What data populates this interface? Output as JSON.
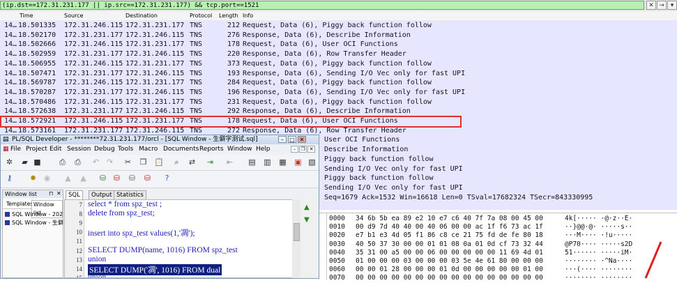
{
  "filter": {
    "text": "(ip.dst==172.31.231.177 || ip.src==172.31.231.177) && tcp.port==1521"
  },
  "packet_list": {
    "columns": [
      "Time",
      "Source",
      "Destination",
      "Protocol",
      "Length",
      "Info"
    ],
    "rows": [
      {
        "no": "14…",
        "time": "18.501335",
        "src": "172.31.246.115",
        "dst": "172.31.231.177",
        "proto": "TNS",
        "len": "212",
        "info": "Request, Data (6), Piggy back function follow"
      },
      {
        "no": "14…",
        "time": "18.502170",
        "src": "172.31.231.177",
        "dst": "172.31.246.115",
        "proto": "TNS",
        "len": "276",
        "info": "Response, Data (6), Describe Information"
      },
      {
        "no": "14…",
        "time": "18.502666",
        "src": "172.31.246.115",
        "dst": "172.31.231.177",
        "proto": "TNS",
        "len": "178",
        "info": "Request, Data (6), User OCI Functions"
      },
      {
        "no": "14…",
        "time": "18.502959",
        "src": "172.31.231.177",
        "dst": "172.31.246.115",
        "proto": "TNS",
        "len": "220",
        "info": "Response, Data (6), Row Transfer Header"
      },
      {
        "no": "14…",
        "time": "18.506955",
        "src": "172.31.246.115",
        "dst": "172.31.231.177",
        "proto": "TNS",
        "len": "373",
        "info": "Request, Data (6), Piggy back function follow"
      },
      {
        "no": "14…",
        "time": "18.507471",
        "src": "172.31.231.177",
        "dst": "172.31.246.115",
        "proto": "TNS",
        "len": "193",
        "info": "Response, Data (6), Sending I/O Vec only for fast UPI"
      },
      {
        "no": "14…",
        "time": "18.569787",
        "src": "172.31.246.115",
        "dst": "172.31.231.177",
        "proto": "TNS",
        "len": "284",
        "info": "Request, Data (6), Piggy back function follow"
      },
      {
        "no": "14…",
        "time": "18.570287",
        "src": "172.31.231.177",
        "dst": "172.31.246.115",
        "proto": "TNS",
        "len": "196",
        "info": "Response, Data (6), Sending I/O Vec only for fast UPI"
      },
      {
        "no": "14…",
        "time": "18.570486",
        "src": "172.31.246.115",
        "dst": "172.31.231.177",
        "proto": "TNS",
        "len": "231",
        "info": "Request, Data (6), Piggy back function follow"
      },
      {
        "no": "14…",
        "time": "18.572638",
        "src": "172.31.231.177",
        "dst": "172.31.246.115",
        "proto": "TNS",
        "len": "292",
        "info": "Response, Data (6), Describe Information"
      },
      {
        "no": "14…",
        "time": "18.572921",
        "src": "172.31.246.115",
        "dst": "172.31.231.177",
        "proto": "TNS",
        "len": "178",
        "info": "Request, Data (6), User OCI Functions"
      },
      {
        "no": "14…",
        "time": "18.573161",
        "src": "172.31.231.177",
        "dst": "172.31.246.115",
        "proto": "TNS",
        "len": "272",
        "info": "Response, Data (6), Row Transfer Header"
      }
    ],
    "hidden_info": [
      "User OCI Functions",
      "Describe Information",
      "Piggy back function follow",
      "Sending I/O Vec only for fast UPI",
      "Piggy back function follow",
      "Sending I/O Vec only for fast UPI",
      "Seq=1679 Ack=1532 Win=16618 Len=0 TSval=17682324 TSecr=843330995"
    ]
  },
  "hex_pane": {
    "rows": [
      {
        "offset": "0000",
        "hex": "34 6b 5b ea 89 e2 10 e7  c6 40 7f 7a 08 00 45 00",
        "ascii": "4k[·····  ·@·z··E·"
      },
      {
        "offset": "0010",
        "hex": "00 d9 7d 40 40 00 40 06  00 00 ac 1f f6 73 ac 1f",
        "ascii": "··}@@·@·  ·····s··"
      },
      {
        "offset": "0020",
        "hex": "e7 b1 e3 4d 05 f1 86 c8  ce 21 75 fd de fe 80 18",
        "ascii": "···M····  ·!u·····"
      },
      {
        "offset": "0030",
        "hex": "40 50 37 30 00 00 01 01  08 0a 01 0d cf 73 32 44",
        "ascii": "@P70····  ·····s2D"
      },
      {
        "offset": "0040",
        "hex": "35 31 00 a5 00 00 06 00  00 00 00 00 11 69 4d 01",
        "ascii": "51······  ·····iM·"
      },
      {
        "offset": "0050",
        "hex": "01 00 00 00 03 00 00 00  03 5e 4e 61 80 00 00 00",
        "ascii": "········  ·^Na····"
      },
      {
        "offset": "0060",
        "hex": "00 00 01 28 00 00 00 01  0d 00 00 00 00 00 01 00",
        "ascii": "···(····  ········"
      },
      {
        "offset": "0070",
        "hex": "00 00 00 00 00 00 00 00  00 00 00 00 00 00 00 00",
        "ascii": "········  ········"
      }
    ]
  },
  "plsql": {
    "title": "PL/SQL Developer - ********72.31.231.177/orcl - [SQL Window - 生僻字测试.sql]",
    "menu": [
      "File",
      "Project",
      "Edit",
      "Session",
      "Debug",
      "Tools",
      "Macro",
      "Documents",
      "Reports",
      "Window",
      "Help"
    ],
    "left_panel": {
      "title": "Window list",
      "tabs": [
        "Templates",
        "Window list"
      ],
      "items": [
        "SQL Window - 202",
        "SQL Window - 生僻"
      ]
    },
    "editor_tabs": [
      "SQL",
      "Output",
      "Statistics"
    ],
    "code": [
      {
        "line": "7",
        "text": "select * from spz_test ;"
      },
      {
        "line": "8",
        "text": "delete from spz_test;"
      },
      {
        "line": "9",
        "text": ""
      },
      {
        "line": "10",
        "text": "insert into spz_test values(1,'凋');"
      },
      {
        "line": "11",
        "text": ""
      },
      {
        "line": "12",
        "text": "SELECT DUMP(name, 1016)  FROM spz_test"
      },
      {
        "line": "13",
        "text": "union"
      },
      {
        "line": "14",
        "text": "SELECT  DUMP('凋', 1016)  FROM dual"
      },
      {
        "line": "15",
        "text": "union"
      }
    ]
  },
  "colors": {
    "packet_bg": "#e7e6ff",
    "filter_bg": "#b6f1b0",
    "highlight_border": "#e03030",
    "code_text": "#1b1bb8",
    "selection_bg": "#102080"
  }
}
